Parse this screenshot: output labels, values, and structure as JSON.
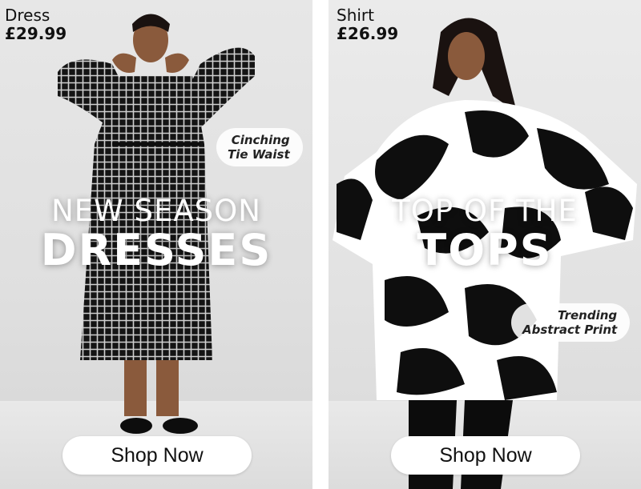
{
  "left_card": {
    "product_name": "Dress",
    "price": "£29.99",
    "headline_line1": "NEW SEASON",
    "headline_line2": "DRESSES",
    "callout_line1": "Cinching",
    "callout_line2": "Tie Waist",
    "cta_label": "Shop Now"
  },
  "right_card": {
    "product_name": "Shirt",
    "price": "£26.99",
    "headline_line1": "TOP OF THE",
    "headline_line2": "TOPS",
    "callout_line1": "Trending",
    "callout_line2": "Abstract Print",
    "cta_label": "Shop Now"
  }
}
